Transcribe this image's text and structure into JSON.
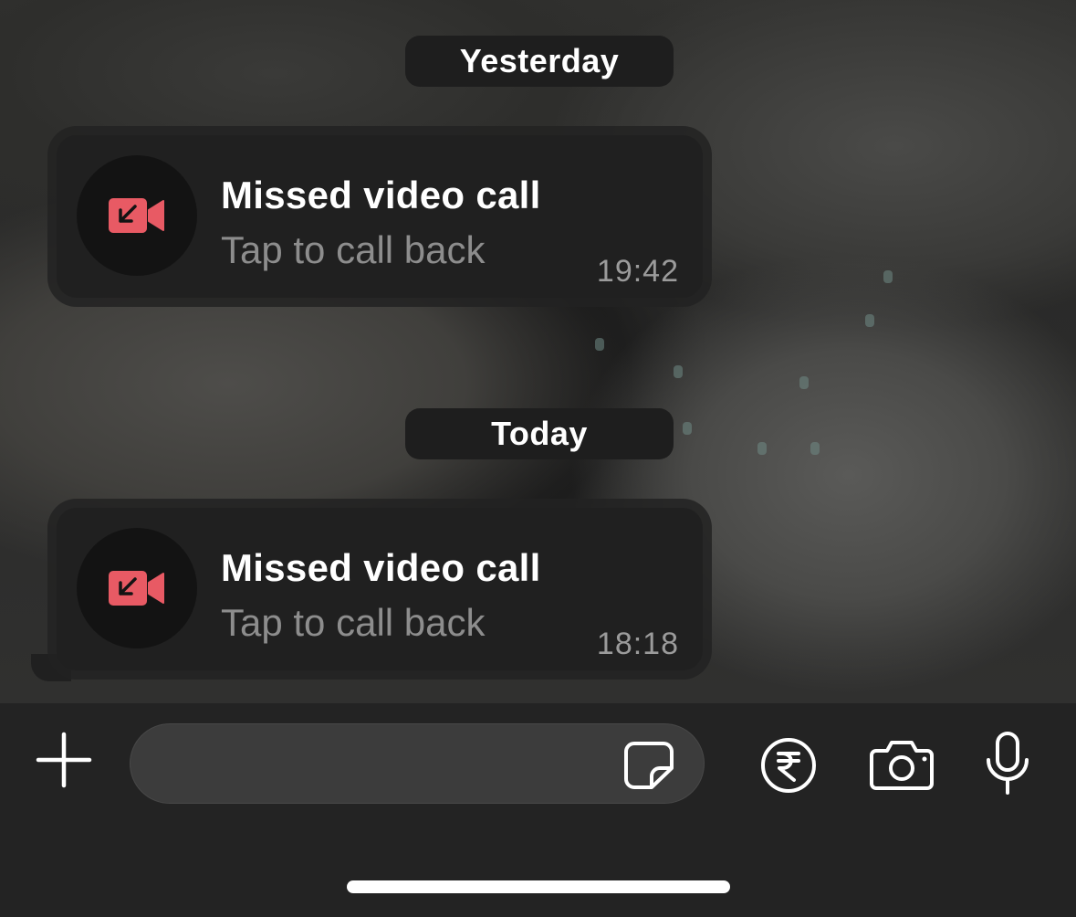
{
  "chat": {
    "date_separators": {
      "yesterday": "Yesterday",
      "today": "Today"
    },
    "calls": [
      {
        "title": "Missed video call",
        "subtitle": "Tap to call back",
        "time": "19:42",
        "icon": "missed-video-call-icon"
      },
      {
        "title": "Missed video call",
        "subtitle": "Tap to call back",
        "time": "18:18",
        "icon": "missed-video-call-icon"
      }
    ]
  },
  "composer": {
    "input_value": "",
    "input_placeholder": "",
    "icons": [
      "plus-icon",
      "sticker-icon",
      "rupee-payment-icon",
      "camera-icon",
      "microphone-icon"
    ]
  },
  "colors": {
    "missed_call_red": "#e85a64",
    "bubble_bg": "#202020",
    "composer_bg": "#232323",
    "timestamp_gray": "#9b9b9b"
  }
}
